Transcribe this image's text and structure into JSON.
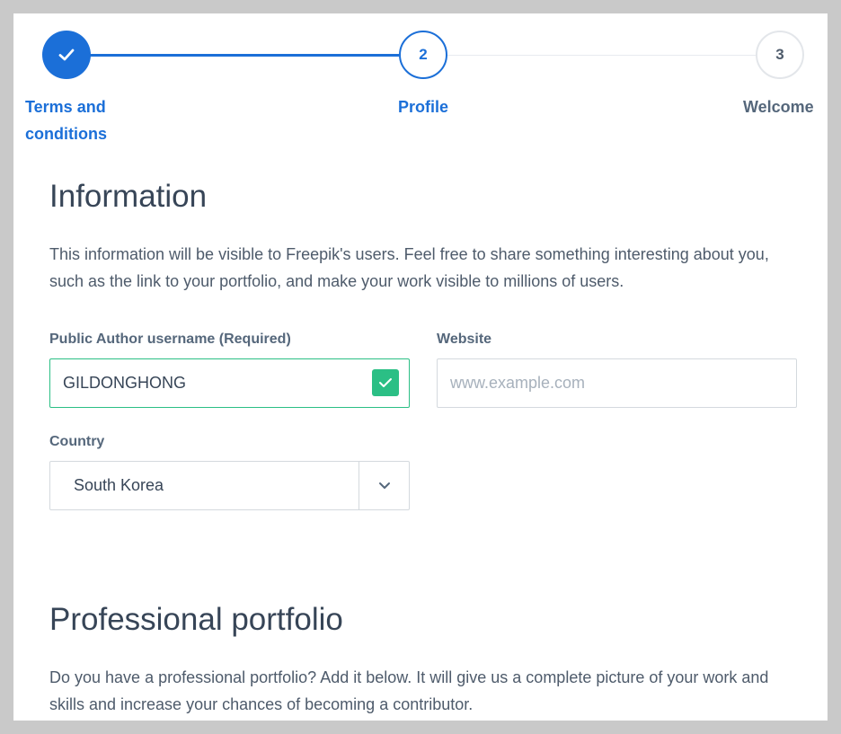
{
  "stepper": {
    "steps": [
      {
        "number": "",
        "label": "Terms and conditions",
        "state": "done"
      },
      {
        "number": "2",
        "label": "Profile",
        "state": "active"
      },
      {
        "number": "3",
        "label": "Welcome",
        "state": "todo"
      }
    ]
  },
  "information": {
    "title": "Information",
    "description": "This information will be visible to Freepik's users. Feel free to share something interesting about you, such as the link to your portfolio, and make your work visible to millions of users."
  },
  "form": {
    "username_label": "Public Author username (Required)",
    "username_value": "GILDONGHONG",
    "website_label": "Website",
    "website_placeholder": "www.example.com",
    "country_label": "Country",
    "country_value": "South Korea"
  },
  "portfolio": {
    "title": "Professional portfolio",
    "description": "Do you have a professional portfolio? Add it below. It will give us a complete picture of your work and skills and increase your chances of becoming a contributor."
  },
  "colors": {
    "accent": "#1b6fd8",
    "success": "#2bbf85"
  }
}
